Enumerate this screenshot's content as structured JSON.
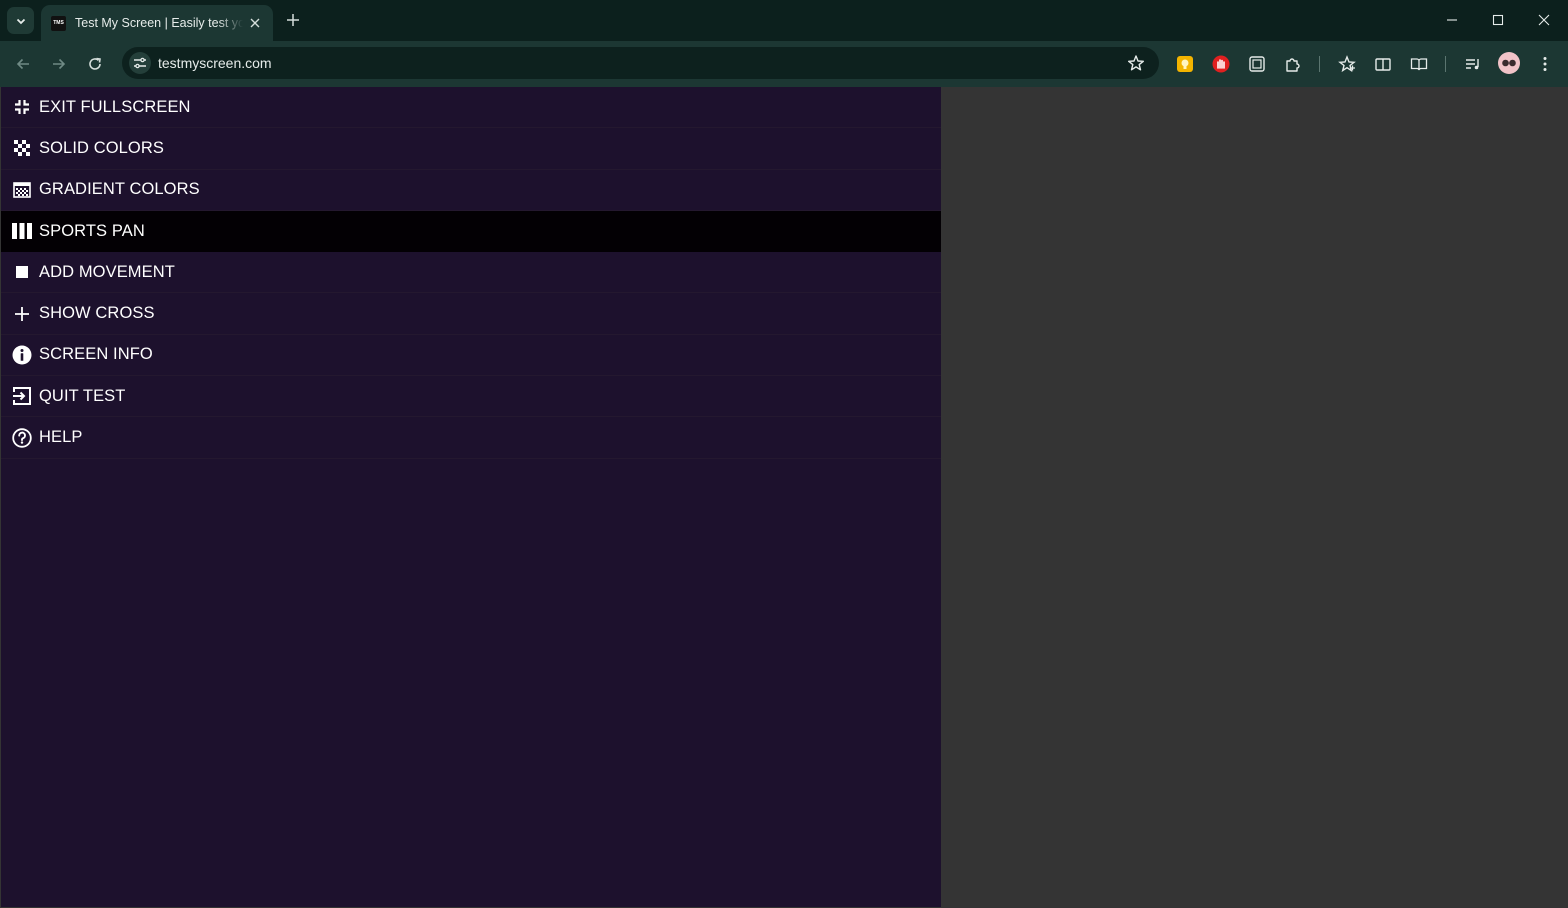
{
  "browser": {
    "tab_title": "Test My Screen | Easily test your",
    "favicon_text": "TMS",
    "url": "testmyscreen.com"
  },
  "icons": {
    "tab_search": "chevron-down-icon",
    "tab_close": "close-icon",
    "new_tab": "plus-icon",
    "minimize": "minimize-icon",
    "maximize": "maximize-icon",
    "window_close": "close-icon",
    "back": "arrow-left-icon",
    "forward": "arrow-right-icon",
    "reload": "reload-icon",
    "site_info": "tune-icon",
    "bookmark": "star-icon",
    "extensions": [
      "yellow-square-extension-icon",
      "red-hand-extension-icon",
      "screenshot-extension-icon",
      "puzzle-icon"
    ],
    "favorites": "favorites-star-icon",
    "tab_groups": "split-screen-icon",
    "reading_list": "reading-mode-icon",
    "media": "media-queue-icon",
    "profile": "avatar",
    "menu": "kebab-menu-icon"
  },
  "menu": {
    "items": [
      {
        "label": "EXIT FULLSCREEN",
        "icon": "exit-fullscreen-icon"
      },
      {
        "label": "SOLID COLORS",
        "icon": "checkerboard-icon"
      },
      {
        "label": "GRADIENT COLORS",
        "icon": "gradient-grid-icon"
      },
      {
        "label": "SPORTS PAN",
        "icon": "columns-icon",
        "active": true
      },
      {
        "label": "ADD MOVEMENT",
        "icon": "square-icon"
      },
      {
        "label": "SHOW CROSS",
        "icon": "plus-icon"
      },
      {
        "label": "SCREEN INFO",
        "icon": "info-icon"
      },
      {
        "label": "QUIT TEST",
        "icon": "exit-box-icon"
      },
      {
        "label": "HELP",
        "icon": "help-circle-icon"
      }
    ]
  },
  "colors": {
    "menu_background": "#1d112d",
    "menu_active": "#030004",
    "page_background": "#343434",
    "chrome_dark": "#0c201d",
    "chrome_toolbar": "#1c3733"
  }
}
